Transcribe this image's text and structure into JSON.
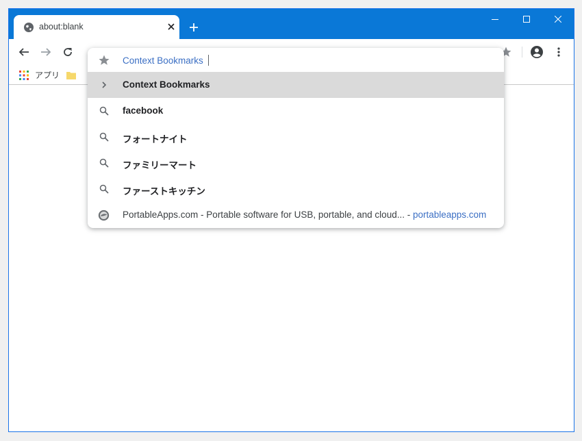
{
  "tab": {
    "title": "about:blank",
    "favicon": "globe-icon"
  },
  "window_controls": {
    "minimize": "minimize-icon",
    "maximize": "maximize-icon",
    "close": "close-icon"
  },
  "toolbar": {
    "back": "back-arrow-icon",
    "forward": "forward-arrow-icon",
    "reload": "reload-icon",
    "bookmark_star": "star-icon",
    "profile": "account-icon",
    "menu": "kebab-menu-icon"
  },
  "bookmarks_bar": {
    "apps_label": "アプリ"
  },
  "omnibox": {
    "input_value": "Context Bookmarks",
    "suggestions": [
      {
        "icon": "chevron-right-icon",
        "text": "Context Bookmarks",
        "selected": true
      },
      {
        "icon": "search-icon",
        "text": "facebook"
      },
      {
        "icon": "search-icon",
        "text": "フォートナイト"
      },
      {
        "icon": "search-icon",
        "text": "ファミリーマート"
      },
      {
        "icon": "search-icon",
        "text": "ファーストキッチン"
      },
      {
        "icon": "site-favicon-icon",
        "title": "PortableApps.com - Portable software for USB, portable, and cloud...",
        "separator": " - ",
        "url": "portableapps.com"
      }
    ]
  },
  "colors": {
    "titlebar": "#0a78d7",
    "accent_text": "#3b6fc4",
    "selected_row": "#dadada"
  }
}
